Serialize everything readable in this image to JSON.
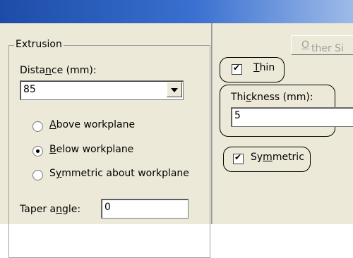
{
  "extrusion": {
    "group_label": "Extrusion",
    "distance_label_pre": "Dista",
    "distance_label_u": "n",
    "distance_label_post": "ce (mm):",
    "distance_value": "85",
    "options": [
      {
        "pre": "",
        "u": "A",
        "post": "bove workplane",
        "checked": false
      },
      {
        "pre": "",
        "u": "B",
        "post": "elow workplane",
        "checked": true
      },
      {
        "pre": "S",
        "u": "y",
        "post": "mmetric about workplane",
        "checked": false
      }
    ],
    "taper_label_pre": "Taper a",
    "taper_label_u": "n",
    "taper_label_post": "gle:",
    "taper_value": "0"
  },
  "right_panel": {
    "thin_label_u": "T",
    "thin_label_post": "hin",
    "thin_checked": true,
    "thickness_label_pre": "Thi",
    "thickness_label_u": "c",
    "thickness_label_post": "kness (mm):",
    "thickness_value": "5",
    "symmetric_label_pre": "Sy",
    "symmetric_label_u": "m",
    "symmetric_label_post": "metric",
    "symmetric_checked": true,
    "other_button_u": "O",
    "other_button_post": "ther Si"
  }
}
